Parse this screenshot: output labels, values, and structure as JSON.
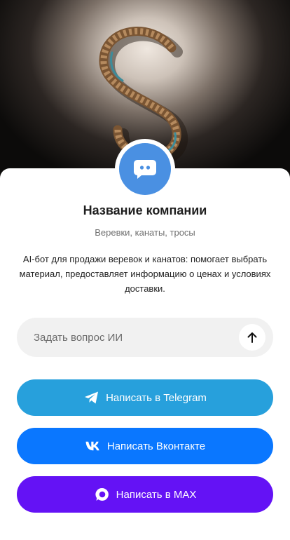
{
  "company": {
    "name": "Название компании",
    "tagline": "Веревки, канаты, тросы",
    "description": "AI-бот для продажи веревок и канатов: помогает выбрать материал, предоставляет информацию о ценах и условиях доставки.",
    "avatar_icon": "chat-bot-icon",
    "avatar_color": "#4a90e2"
  },
  "hero": {
    "image": "rope-s-shape-photo"
  },
  "ask": {
    "placeholder": "Задать вопрос ИИ",
    "value": "",
    "send_icon": "arrow-up-icon"
  },
  "buttons": {
    "telegram": {
      "label": "Написать в Telegram",
      "icon": "telegram-icon",
      "color": "#27a0dc"
    },
    "vk": {
      "label": "Написать Вконтакте",
      "icon": "vk-icon",
      "color": "#0a77ff"
    },
    "max": {
      "label": "Написать в MAX",
      "icon": "max-icon",
      "color": "#6412f5"
    }
  }
}
